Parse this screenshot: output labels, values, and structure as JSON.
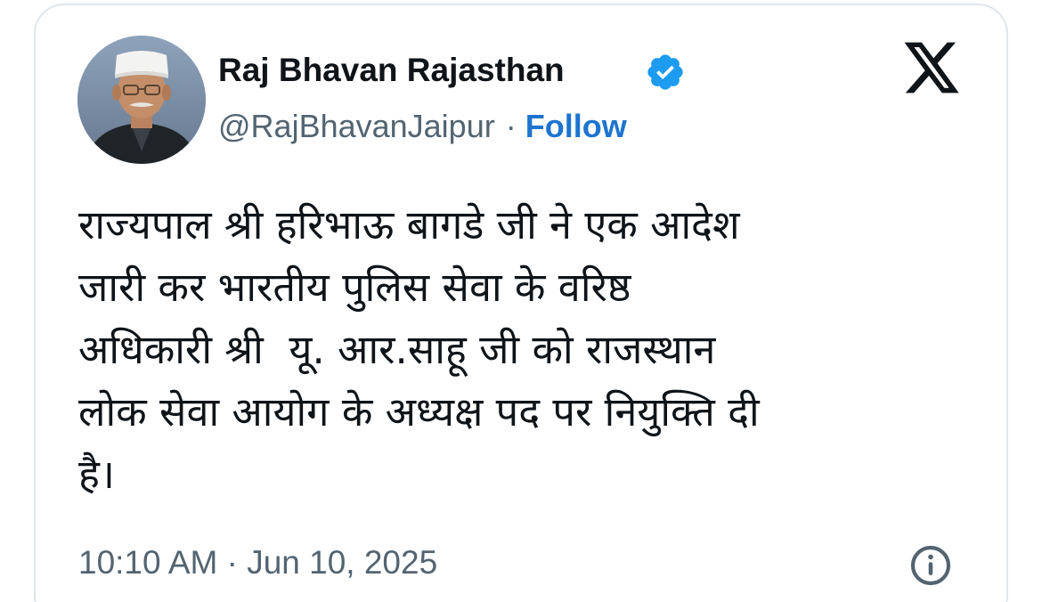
{
  "tweet": {
    "author": {
      "display_name": "Raj Bhavan Rajasthan",
      "handle": "@RajBhavanJaipur",
      "separator": "·",
      "follow_label": "Follow",
      "verified": true,
      "avatar_icon": "profile-photo"
    },
    "brand_icon": "x-logo-icon",
    "text": "राज्यपाल श्री हरिभाऊ बागडे जी ने एक आदेश\nजारी कर भारतीय पुलिस सेवा के वरिष्ठ\nअधिकारी श्री  यू. आर.साहू जी को राजस्थान\nलोक सेवा आयोग के अध्यक्ष पद पर नियुक्ति दी\nहै।",
    "timestamp": "10:10 AM · Jun 10, 2025",
    "info_icon": "info-icon"
  },
  "colors": {
    "text_primary": "#0f1419",
    "text_secondary": "#536471",
    "link": "#1d74cf",
    "verified_badge": "#1d9bf0",
    "border": "#e1e6ea"
  }
}
